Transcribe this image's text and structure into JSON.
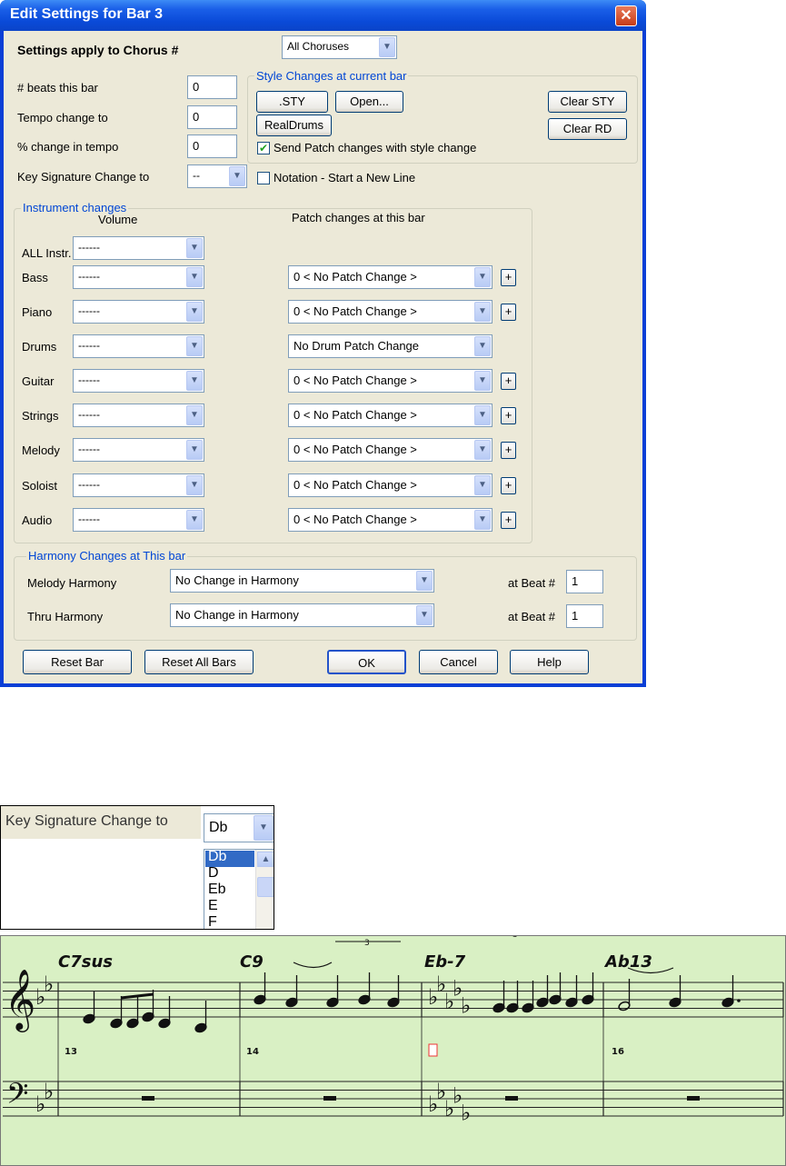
{
  "dialog": {
    "title": "Edit Settings for Bar 3",
    "close_symbol": "✕",
    "chorus_label": "Settings apply to Chorus #",
    "chorus_value": "All Choruses",
    "beats_label": "# beats this bar",
    "beats_value": "0",
    "tempo_label": "Tempo change to",
    "tempo_value": "0",
    "pct_label": "% change in tempo",
    "pct_value": "0",
    "keysig_label": "Key Signature Change to",
    "keysig_value": "--",
    "style_group": {
      "title": "Style Changes at current bar",
      "sty_btn": ".STY",
      "open_btn": "Open...",
      "realdrums_btn": "RealDrums",
      "clear_sty_btn": "Clear STY",
      "clear_rd_btn": "Clear RD",
      "send_patch_label": "Send Patch changes with style change",
      "send_patch_checked": true
    },
    "notation_label": "Notation - Start a New Line",
    "notation_checked": false,
    "instruments": {
      "title": "Instrument changes",
      "volume_header": "Volume",
      "patch_header": "Patch changes at this bar",
      "rows": [
        {
          "name": "ALL Instr.",
          "volume": "------",
          "patch": ""
        },
        {
          "name": "Bass",
          "volume": "------",
          "patch": "0 < No Patch Change >"
        },
        {
          "name": "Piano",
          "volume": "------",
          "patch": "0 < No Patch Change >"
        },
        {
          "name": "Drums",
          "volume": "------",
          "patch": "No Drum Patch Change"
        },
        {
          "name": "Guitar",
          "volume": "------",
          "patch": "0 < No Patch Change >"
        },
        {
          "name": "Strings",
          "volume": "------",
          "patch": "0 < No Patch Change >"
        },
        {
          "name": "Melody",
          "volume": "------",
          "patch": "0 < No Patch Change >"
        },
        {
          "name": "Soloist",
          "volume": "------",
          "patch": "0 < No Patch Change >"
        },
        {
          "name": "Audio",
          "volume": "------",
          "patch": "0 < No Patch Change >"
        }
      ],
      "plus_label": "+"
    },
    "harmony": {
      "title": "Harmony Changes at This bar",
      "melody_label": "Melody Harmony",
      "melody_value": "No Change in Harmony",
      "melody_beat_label": "at Beat #",
      "melody_beat": "1",
      "thru_label": "Thru Harmony",
      "thru_value": "No Change in Harmony",
      "thru_beat_label": "at Beat #",
      "thru_beat": "1"
    },
    "buttons": {
      "reset_bar": "Reset Bar",
      "reset_all": "Reset All Bars",
      "ok": "OK",
      "cancel": "Cancel",
      "help": "Help"
    }
  },
  "keysig_popup": {
    "label": "Key Signature Change to",
    "value": "Db",
    "options": [
      "Db",
      "D",
      "Eb",
      "E",
      "F"
    ],
    "selected": "Db"
  },
  "notation": {
    "chords": [
      "C7sus",
      "C9",
      "Eb-7",
      "Ab13"
    ],
    "bar_numbers": [
      "13",
      "14",
      "",
      "16"
    ],
    "triplet_label": "3"
  }
}
